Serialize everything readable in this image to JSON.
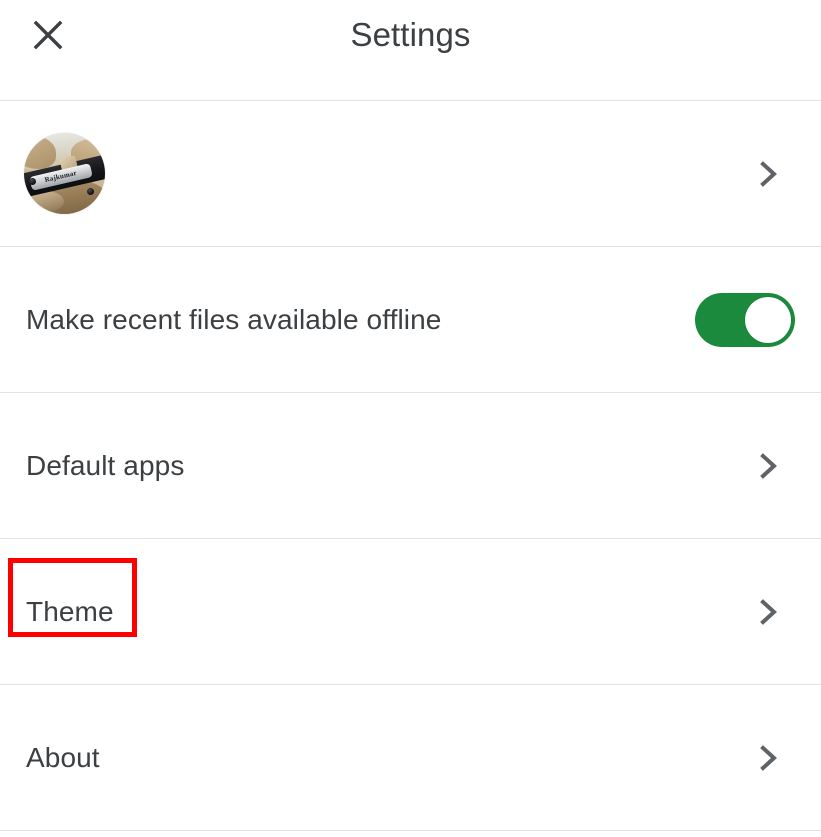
{
  "window": {
    "title": "Settings"
  },
  "header": {
    "title": "Settings",
    "close_icon": "close-icon",
    "close_label": "Close"
  },
  "colors": {
    "background": "#ffffff",
    "text_primary": "#3c4043",
    "divider": "#e3e3e3",
    "toggle_on": "#1b8a3c",
    "toggle_knob": "#ffffff",
    "annotation": "#ff0000"
  },
  "account": {
    "type": "account-row",
    "avatar_icon": "avatar",
    "avatar_alt": "Profile photo of a black leather bracelet with an engraved silver plate on sandy stones",
    "avatar_plate_text": "Rajkumar",
    "trailing_icon": "chevron-right-icon",
    "label": ""
  },
  "settings_rows": [
    {
      "id": "offline",
      "label": "Make recent files available offline",
      "control": "toggle",
      "toggle_state": "on",
      "highlighted": false
    },
    {
      "id": "default-apps",
      "label": "Default apps",
      "control": "chevron",
      "trailing_icon": "chevron-right-icon",
      "highlighted": false
    },
    {
      "id": "theme",
      "label": "Theme",
      "control": "chevron",
      "trailing_icon": "chevron-right-icon",
      "highlighted": true
    },
    {
      "id": "about",
      "label": "About",
      "control": "chevron",
      "trailing_icon": "chevron-right-icon",
      "highlighted": false
    }
  ],
  "annotation": {
    "target": "Theme",
    "shape": "rectangle",
    "color": "#ff0000"
  }
}
